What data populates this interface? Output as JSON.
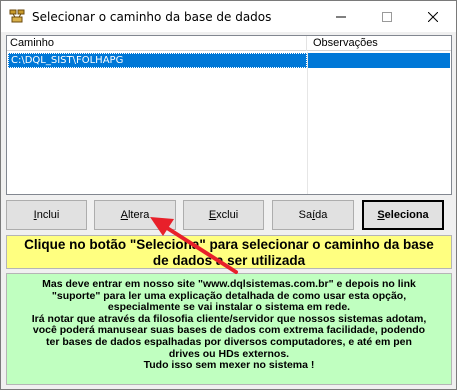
{
  "window": {
    "title": "Selecionar o caminho da base de dados",
    "icon": "database-connection-icon",
    "controls": {
      "minimize": "minimize-icon",
      "maximize": "maximize-icon",
      "close": "close-icon"
    }
  },
  "list": {
    "columns": [
      "Caminho",
      "Observações"
    ],
    "rows": [
      {
        "caminho": "C:\\DQL_SIST\\FOLHAPG",
        "observacoes": ""
      }
    ],
    "selected_color": "#0078d7"
  },
  "buttons": {
    "inclui": {
      "pre": "",
      "u": "I",
      "post": "nclui"
    },
    "altera": {
      "pre": "",
      "u": "A",
      "post": "ltera"
    },
    "exclui": {
      "pre": "",
      "u": "E",
      "post": "xclui"
    },
    "saida": {
      "pre": "Sa",
      "u": "í",
      "post": "da"
    },
    "seleciona": {
      "pre": "",
      "u": "S",
      "post": "eleciona"
    }
  },
  "instruction": {
    "line1": "Clique no botão \"Seleciona\" para selecionar o caminho da base",
    "line2": "de dados a ser utilizada",
    "background": "#ffff80"
  },
  "info": {
    "lines": [
      "Mas deve entrar em nosso site \"www.dqlsistemas.com.br\" e depois no link",
      "\"suporte\" para ler uma explicação detalhada de como usar esta opção,",
      "especialmente se vai instalar o sistema em rede.",
      "Irá notar que através da filosofia cliente/servidor que nossos sistemas adotam,",
      "você poderá manusear suas bases de dados com extrema facilidade, podendo",
      "ter bases de dados espalhadas por diversos computadores, e até em pen",
      "drives ou HDs externos.",
      "Tudo isso sem mexer no sistema !"
    ],
    "background": "#c0ffc0"
  },
  "annotation": {
    "arrow_color": "#e8202a",
    "points_to": "altera-button"
  }
}
